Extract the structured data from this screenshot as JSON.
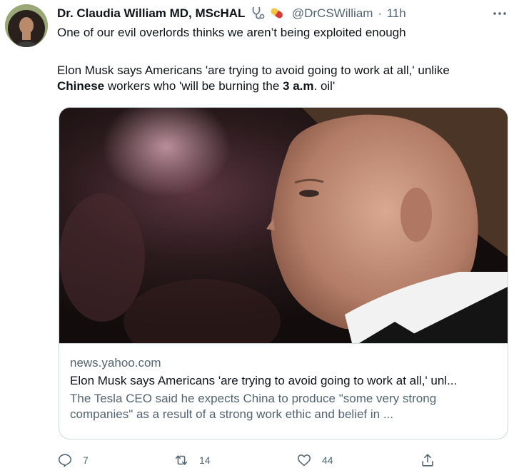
{
  "author": {
    "display_name": "Dr. Claudia William MD, MScHAL",
    "name_emoji": [
      "stethoscope-icon",
      "pill-icon"
    ],
    "handle": "@DrCSWilliam",
    "separator": "·",
    "time": "11h"
  },
  "tweet": {
    "line1": "One of our evil overlords thinks we aren’t being exploited enough",
    "line2_part1": "Elon Musk says Americans 'are trying to avoid going to work at all,' unlike",
    "line3_bold1": "Chinese",
    "line3_part2": " workers who 'will be burning the ",
    "line3_bold2": "3 a.m",
    "line3_part3": ". oil'"
  },
  "card": {
    "domain": "news.yahoo.com",
    "title": "Elon Musk says Americans 'are trying to avoid going to work at all,' unl...",
    "description": "The Tesla CEO said he expects China to produce \"some very strong companies\" as a result of a strong work ethic and belief in ..."
  },
  "actions": {
    "reply_count": "7",
    "retweet_count": "14",
    "like_count": "44"
  },
  "colors": {
    "text_primary": "#0f1419",
    "text_secondary": "#536471",
    "border": "#cfd9de"
  }
}
